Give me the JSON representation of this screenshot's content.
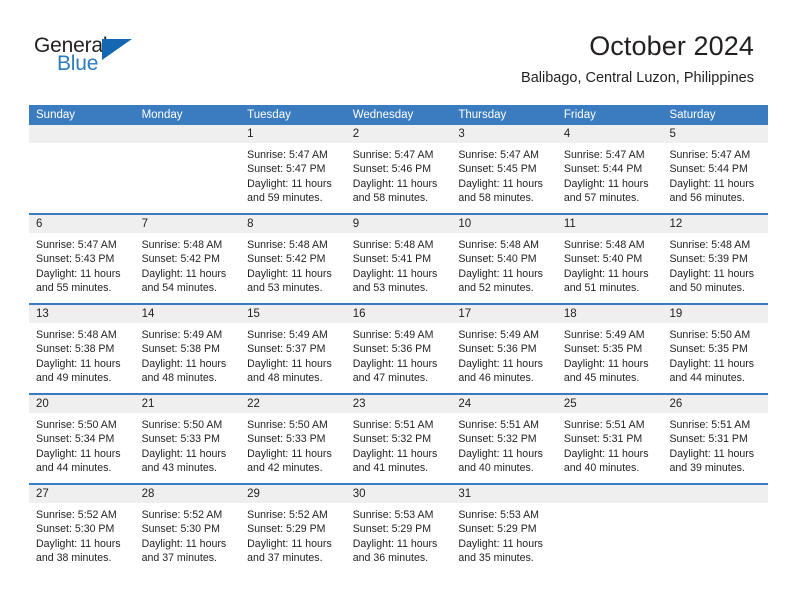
{
  "brand": {
    "name_part1": "General",
    "name_part2": "Blue",
    "triangle_icon": "triangle-icon",
    "accent_color": "#1567b1",
    "text_color": "#231f20"
  },
  "header": {
    "title": "October 2024",
    "subtitle": "Balibago, Central Luzon, Philippines"
  },
  "calendar": {
    "header_bg": "#3b7cc0",
    "band_bg": "#efefef",
    "weekdays": [
      "Sunday",
      "Monday",
      "Tuesday",
      "Wednesday",
      "Thursday",
      "Friday",
      "Saturday"
    ],
    "weeks": [
      {
        "days": [
          {
            "num": "",
            "sunrise": "",
            "sunset": "",
            "daylight1": "",
            "daylight2": "",
            "empty": true
          },
          {
            "num": "",
            "sunrise": "",
            "sunset": "",
            "daylight1": "",
            "daylight2": "",
            "empty": true
          },
          {
            "num": "1",
            "sunrise": "Sunrise: 5:47 AM",
            "sunset": "Sunset: 5:47 PM",
            "daylight1": "Daylight: 11 hours",
            "daylight2": "and 59 minutes.",
            "empty": false
          },
          {
            "num": "2",
            "sunrise": "Sunrise: 5:47 AM",
            "sunset": "Sunset: 5:46 PM",
            "daylight1": "Daylight: 11 hours",
            "daylight2": "and 58 minutes.",
            "empty": false
          },
          {
            "num": "3",
            "sunrise": "Sunrise: 5:47 AM",
            "sunset": "Sunset: 5:45 PM",
            "daylight1": "Daylight: 11 hours",
            "daylight2": "and 58 minutes.",
            "empty": false
          },
          {
            "num": "4",
            "sunrise": "Sunrise: 5:47 AM",
            "sunset": "Sunset: 5:44 PM",
            "daylight1": "Daylight: 11 hours",
            "daylight2": "and 57 minutes.",
            "empty": false
          },
          {
            "num": "5",
            "sunrise": "Sunrise: 5:47 AM",
            "sunset": "Sunset: 5:44 PM",
            "daylight1": "Daylight: 11 hours",
            "daylight2": "and 56 minutes.",
            "empty": false
          }
        ]
      },
      {
        "days": [
          {
            "num": "6",
            "sunrise": "Sunrise: 5:47 AM",
            "sunset": "Sunset: 5:43 PM",
            "daylight1": "Daylight: 11 hours",
            "daylight2": "and 55 minutes.",
            "empty": false
          },
          {
            "num": "7",
            "sunrise": "Sunrise: 5:48 AM",
            "sunset": "Sunset: 5:42 PM",
            "daylight1": "Daylight: 11 hours",
            "daylight2": "and 54 minutes.",
            "empty": false
          },
          {
            "num": "8",
            "sunrise": "Sunrise: 5:48 AM",
            "sunset": "Sunset: 5:42 PM",
            "daylight1": "Daylight: 11 hours",
            "daylight2": "and 53 minutes.",
            "empty": false
          },
          {
            "num": "9",
            "sunrise": "Sunrise: 5:48 AM",
            "sunset": "Sunset: 5:41 PM",
            "daylight1": "Daylight: 11 hours",
            "daylight2": "and 53 minutes.",
            "empty": false
          },
          {
            "num": "10",
            "sunrise": "Sunrise: 5:48 AM",
            "sunset": "Sunset: 5:40 PM",
            "daylight1": "Daylight: 11 hours",
            "daylight2": "and 52 minutes.",
            "empty": false
          },
          {
            "num": "11",
            "sunrise": "Sunrise: 5:48 AM",
            "sunset": "Sunset: 5:40 PM",
            "daylight1": "Daylight: 11 hours",
            "daylight2": "and 51 minutes.",
            "empty": false
          },
          {
            "num": "12",
            "sunrise": "Sunrise: 5:48 AM",
            "sunset": "Sunset: 5:39 PM",
            "daylight1": "Daylight: 11 hours",
            "daylight2": "and 50 minutes.",
            "empty": false
          }
        ]
      },
      {
        "days": [
          {
            "num": "13",
            "sunrise": "Sunrise: 5:48 AM",
            "sunset": "Sunset: 5:38 PM",
            "daylight1": "Daylight: 11 hours",
            "daylight2": "and 49 minutes.",
            "empty": false
          },
          {
            "num": "14",
            "sunrise": "Sunrise: 5:49 AM",
            "sunset": "Sunset: 5:38 PM",
            "daylight1": "Daylight: 11 hours",
            "daylight2": "and 48 minutes.",
            "empty": false
          },
          {
            "num": "15",
            "sunrise": "Sunrise: 5:49 AM",
            "sunset": "Sunset: 5:37 PM",
            "daylight1": "Daylight: 11 hours",
            "daylight2": "and 48 minutes.",
            "empty": false
          },
          {
            "num": "16",
            "sunrise": "Sunrise: 5:49 AM",
            "sunset": "Sunset: 5:36 PM",
            "daylight1": "Daylight: 11 hours",
            "daylight2": "and 47 minutes.",
            "empty": false
          },
          {
            "num": "17",
            "sunrise": "Sunrise: 5:49 AM",
            "sunset": "Sunset: 5:36 PM",
            "daylight1": "Daylight: 11 hours",
            "daylight2": "and 46 minutes.",
            "empty": false
          },
          {
            "num": "18",
            "sunrise": "Sunrise: 5:49 AM",
            "sunset": "Sunset: 5:35 PM",
            "daylight1": "Daylight: 11 hours",
            "daylight2": "and 45 minutes.",
            "empty": false
          },
          {
            "num": "19",
            "sunrise": "Sunrise: 5:50 AM",
            "sunset": "Sunset: 5:35 PM",
            "daylight1": "Daylight: 11 hours",
            "daylight2": "and 44 minutes.",
            "empty": false
          }
        ]
      },
      {
        "days": [
          {
            "num": "20",
            "sunrise": "Sunrise: 5:50 AM",
            "sunset": "Sunset: 5:34 PM",
            "daylight1": "Daylight: 11 hours",
            "daylight2": "and 44 minutes.",
            "empty": false
          },
          {
            "num": "21",
            "sunrise": "Sunrise: 5:50 AM",
            "sunset": "Sunset: 5:33 PM",
            "daylight1": "Daylight: 11 hours",
            "daylight2": "and 43 minutes.",
            "empty": false
          },
          {
            "num": "22",
            "sunrise": "Sunrise: 5:50 AM",
            "sunset": "Sunset: 5:33 PM",
            "daylight1": "Daylight: 11 hours",
            "daylight2": "and 42 minutes.",
            "empty": false
          },
          {
            "num": "23",
            "sunrise": "Sunrise: 5:51 AM",
            "sunset": "Sunset: 5:32 PM",
            "daylight1": "Daylight: 11 hours",
            "daylight2": "and 41 minutes.",
            "empty": false
          },
          {
            "num": "24",
            "sunrise": "Sunrise: 5:51 AM",
            "sunset": "Sunset: 5:32 PM",
            "daylight1": "Daylight: 11 hours",
            "daylight2": "and 40 minutes.",
            "empty": false
          },
          {
            "num": "25",
            "sunrise": "Sunrise: 5:51 AM",
            "sunset": "Sunset: 5:31 PM",
            "daylight1": "Daylight: 11 hours",
            "daylight2": "and 40 minutes.",
            "empty": false
          },
          {
            "num": "26",
            "sunrise": "Sunrise: 5:51 AM",
            "sunset": "Sunset: 5:31 PM",
            "daylight1": "Daylight: 11 hours",
            "daylight2": "and 39 minutes.",
            "empty": false
          }
        ]
      },
      {
        "days": [
          {
            "num": "27",
            "sunrise": "Sunrise: 5:52 AM",
            "sunset": "Sunset: 5:30 PM",
            "daylight1": "Daylight: 11 hours",
            "daylight2": "and 38 minutes.",
            "empty": false
          },
          {
            "num": "28",
            "sunrise": "Sunrise: 5:52 AM",
            "sunset": "Sunset: 5:30 PM",
            "daylight1": "Daylight: 11 hours",
            "daylight2": "and 37 minutes.",
            "empty": false
          },
          {
            "num": "29",
            "sunrise": "Sunrise: 5:52 AM",
            "sunset": "Sunset: 5:29 PM",
            "daylight1": "Daylight: 11 hours",
            "daylight2": "and 37 minutes.",
            "empty": false
          },
          {
            "num": "30",
            "sunrise": "Sunrise: 5:53 AM",
            "sunset": "Sunset: 5:29 PM",
            "daylight1": "Daylight: 11 hours",
            "daylight2": "and 36 minutes.",
            "empty": false
          },
          {
            "num": "31",
            "sunrise": "Sunrise: 5:53 AM",
            "sunset": "Sunset: 5:29 PM",
            "daylight1": "Daylight: 11 hours",
            "daylight2": "and 35 minutes.",
            "empty": false
          },
          {
            "num": "",
            "sunrise": "",
            "sunset": "",
            "daylight1": "",
            "daylight2": "",
            "empty": true
          },
          {
            "num": "",
            "sunrise": "",
            "sunset": "",
            "daylight1": "",
            "daylight2": "",
            "empty": true
          }
        ]
      }
    ]
  }
}
